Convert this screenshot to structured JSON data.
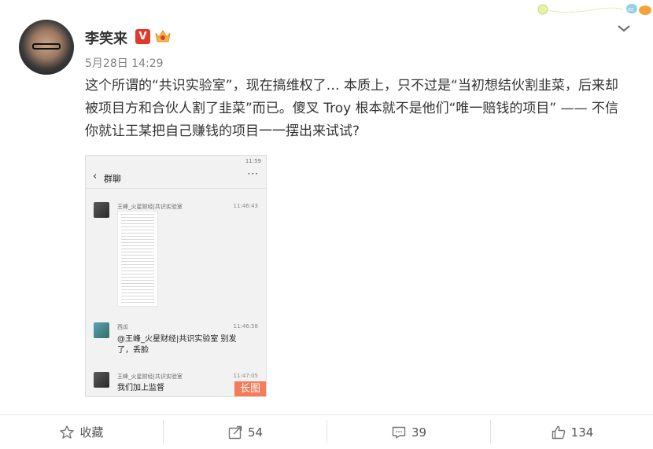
{
  "post": {
    "username": "李笑来",
    "verified_badge": "V",
    "time": "5月28日 14:29",
    "text": "这个所谓的“共识实验室”，现在搞维权了… 本质上，只不过是“当初想结伙割韭菜，后来却被项目方和合伙人割了韭菜”而已。傻叉 Troy 根本就不是他们“唯一赔钱的项目” —— 不信你就让王某把自己赚钱的项目一一摆出来试试?"
  },
  "screenshot": {
    "status_time": "11:59",
    "chat_title": "群聊",
    "back_icon": "back-arrow-icon",
    "more_icon": "more-dots-icon",
    "messages": [
      {
        "sender": "王峰_火星财经|共识实验室",
        "time": "11:46:43",
        "content": ""
      },
      {
        "sender": "西瓜",
        "time": "11:46:58",
        "content": "@王峰_火星财经|共识实验室 别发了，丢脸"
      },
      {
        "sender": "王峰_火星财经|共识实验室",
        "time": "11:47:05",
        "content": "我们加上监督"
      }
    ],
    "long_image_badge": "长图"
  },
  "actions": {
    "favorite": {
      "label": "收藏",
      "icon": "star-icon"
    },
    "repost": {
      "count": "54",
      "icon": "share-icon"
    },
    "comment": {
      "count": "39",
      "icon": "comment-icon"
    },
    "like": {
      "count": "134",
      "icon": "thumbs-up-icon"
    }
  },
  "colors": {
    "accent_red": "#e03a2f",
    "badge_orange": "#f47c5b",
    "text": "#333333",
    "muted": "#808080"
  }
}
